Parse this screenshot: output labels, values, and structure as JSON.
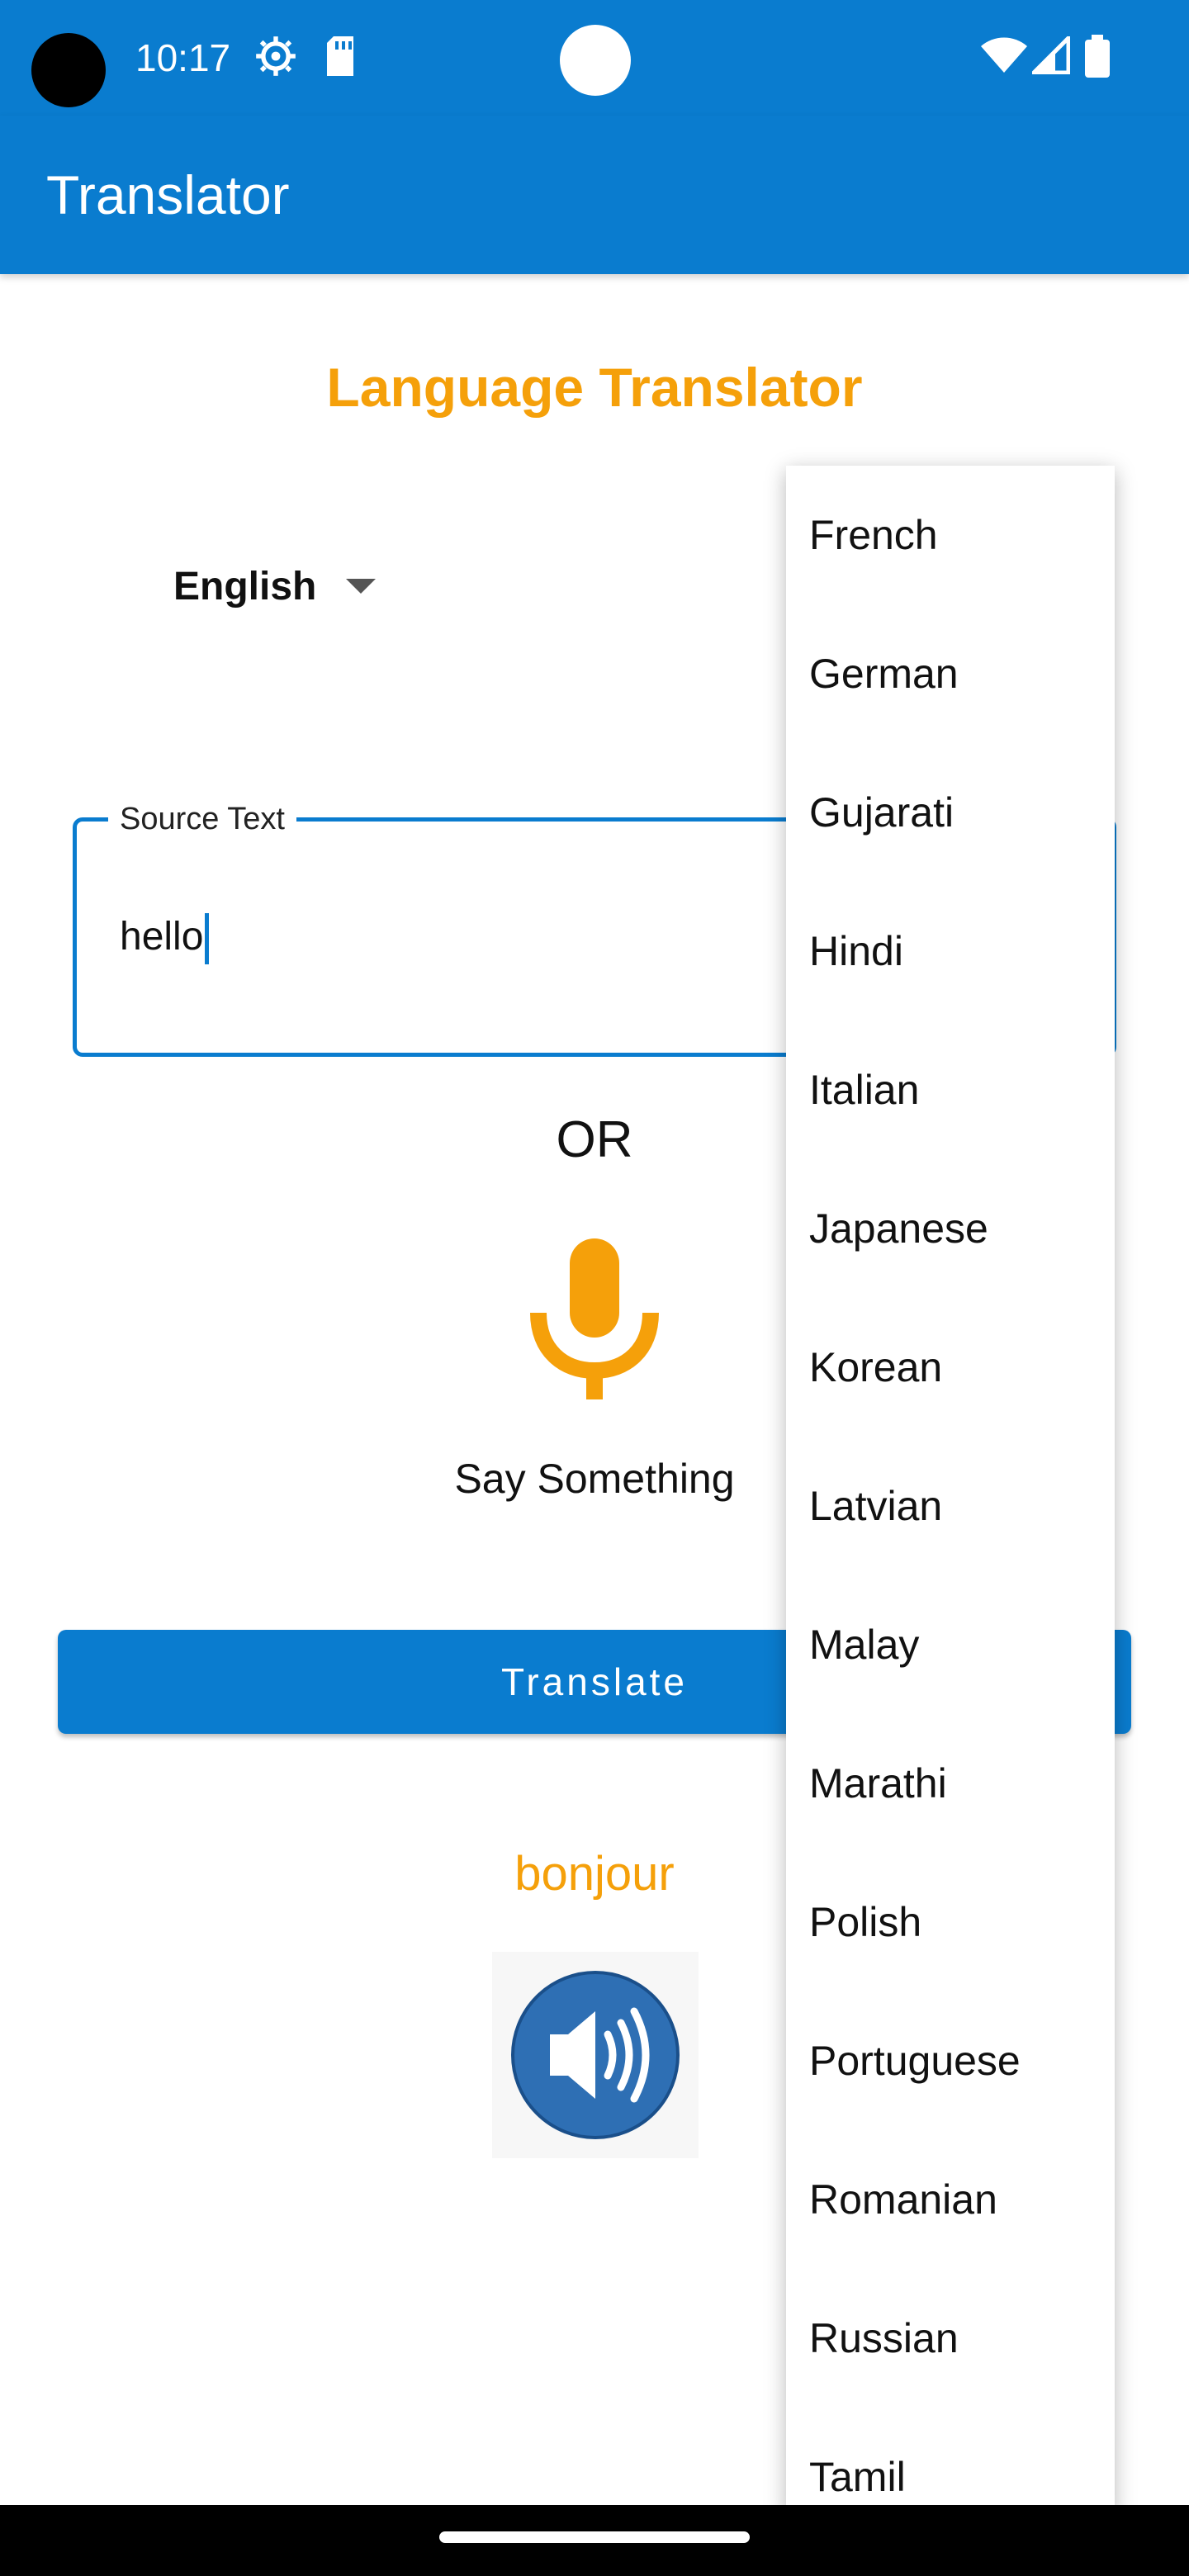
{
  "status_bar": {
    "time": "10:17",
    "icons": [
      "settings-gear-icon",
      "sd-card-icon",
      "wifi-icon",
      "signal-icon",
      "battery-icon"
    ]
  },
  "app_bar": {
    "title": "Translator"
  },
  "heading": "Language Translator",
  "source_language": {
    "selected": "English"
  },
  "source_text": {
    "label": "Source Text",
    "value": "hello"
  },
  "or_label": "OR",
  "mic": {
    "label": "Say Something"
  },
  "translate_button": {
    "label": "Translate"
  },
  "result": {
    "text": "bonjour"
  },
  "dropdown": {
    "items": [
      "French",
      "German",
      "Gujarati",
      "Hindi",
      "Italian",
      "Japanese",
      "Korean",
      "Latvian",
      "Malay",
      "Marathi",
      "Polish",
      "Portuguese",
      "Romanian",
      "Russian",
      "Tamil"
    ]
  },
  "colors": {
    "primary": "#0a7ccf",
    "accent": "#f5a00a"
  }
}
